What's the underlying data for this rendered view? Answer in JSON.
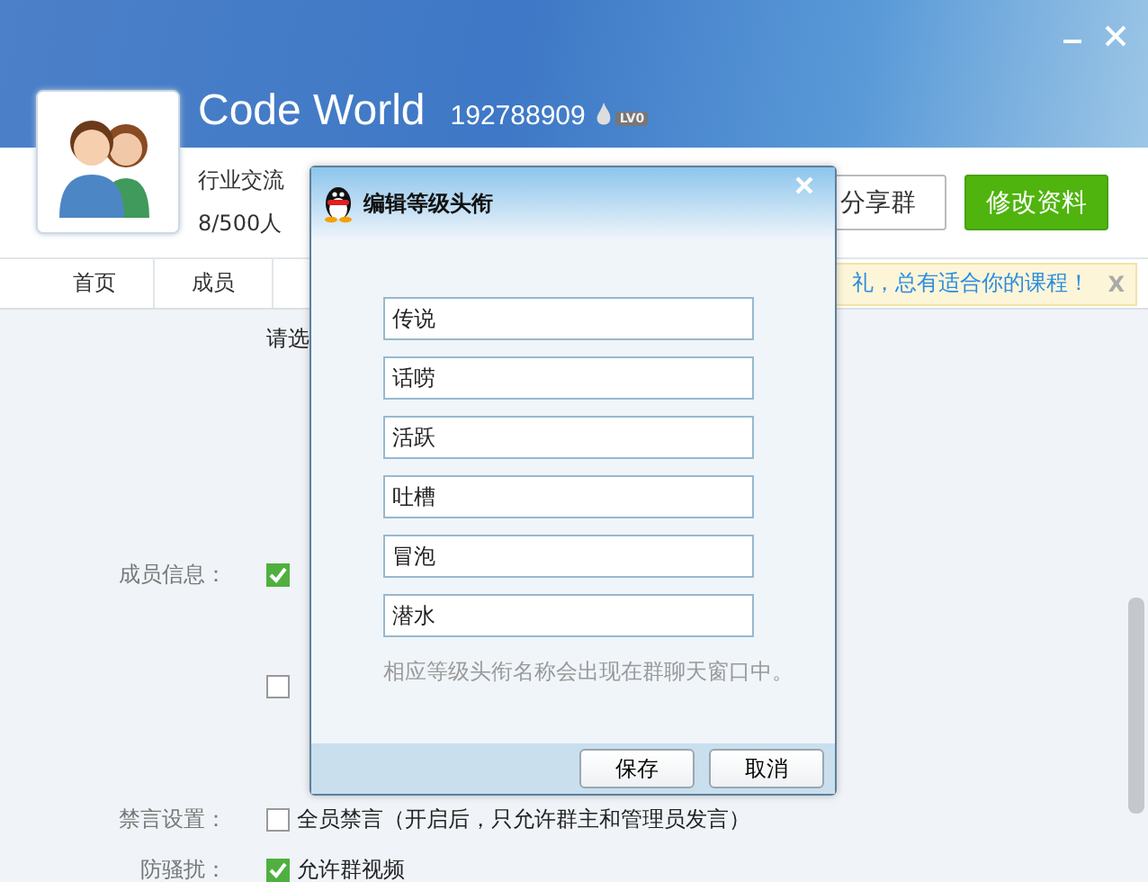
{
  "group": {
    "name": "Code World",
    "number": "192788909",
    "level_badge": "LV0",
    "category": "行业交流",
    "members": "8/500人"
  },
  "actions": [
    {
      "label": "分享群",
      "kind": "outline"
    },
    {
      "label": "修改资料",
      "kind": "primary"
    }
  ],
  "tabs": [
    {
      "label": "首页",
      "selected": false
    },
    {
      "label": "成员",
      "selected": false
    }
  ],
  "banner": {
    "text": "礼，总有适合你的课程！",
    "close": "X"
  },
  "settings": {
    "intro": "请选",
    "rows": [
      {
        "label": "成员信息：",
        "checked": true
      },
      {
        "checked": false
      },
      {
        "label": "禁言设置：",
        "option": "全员禁言（开启后，只允许群主和管理员发言）",
        "checked": false
      },
      {
        "label": "防骚扰：",
        "option": "允许群视频",
        "checked": true
      }
    ]
  },
  "dialog": {
    "title": "编辑等级头衔",
    "level_titles": [
      "传说",
      "话唠",
      "活跃",
      "吐槽",
      "冒泡",
      "潜水"
    ],
    "hint": "相应等级头衔名称会出现在群聊天窗口中。",
    "buttons": [
      "保存",
      "取消"
    ]
  }
}
